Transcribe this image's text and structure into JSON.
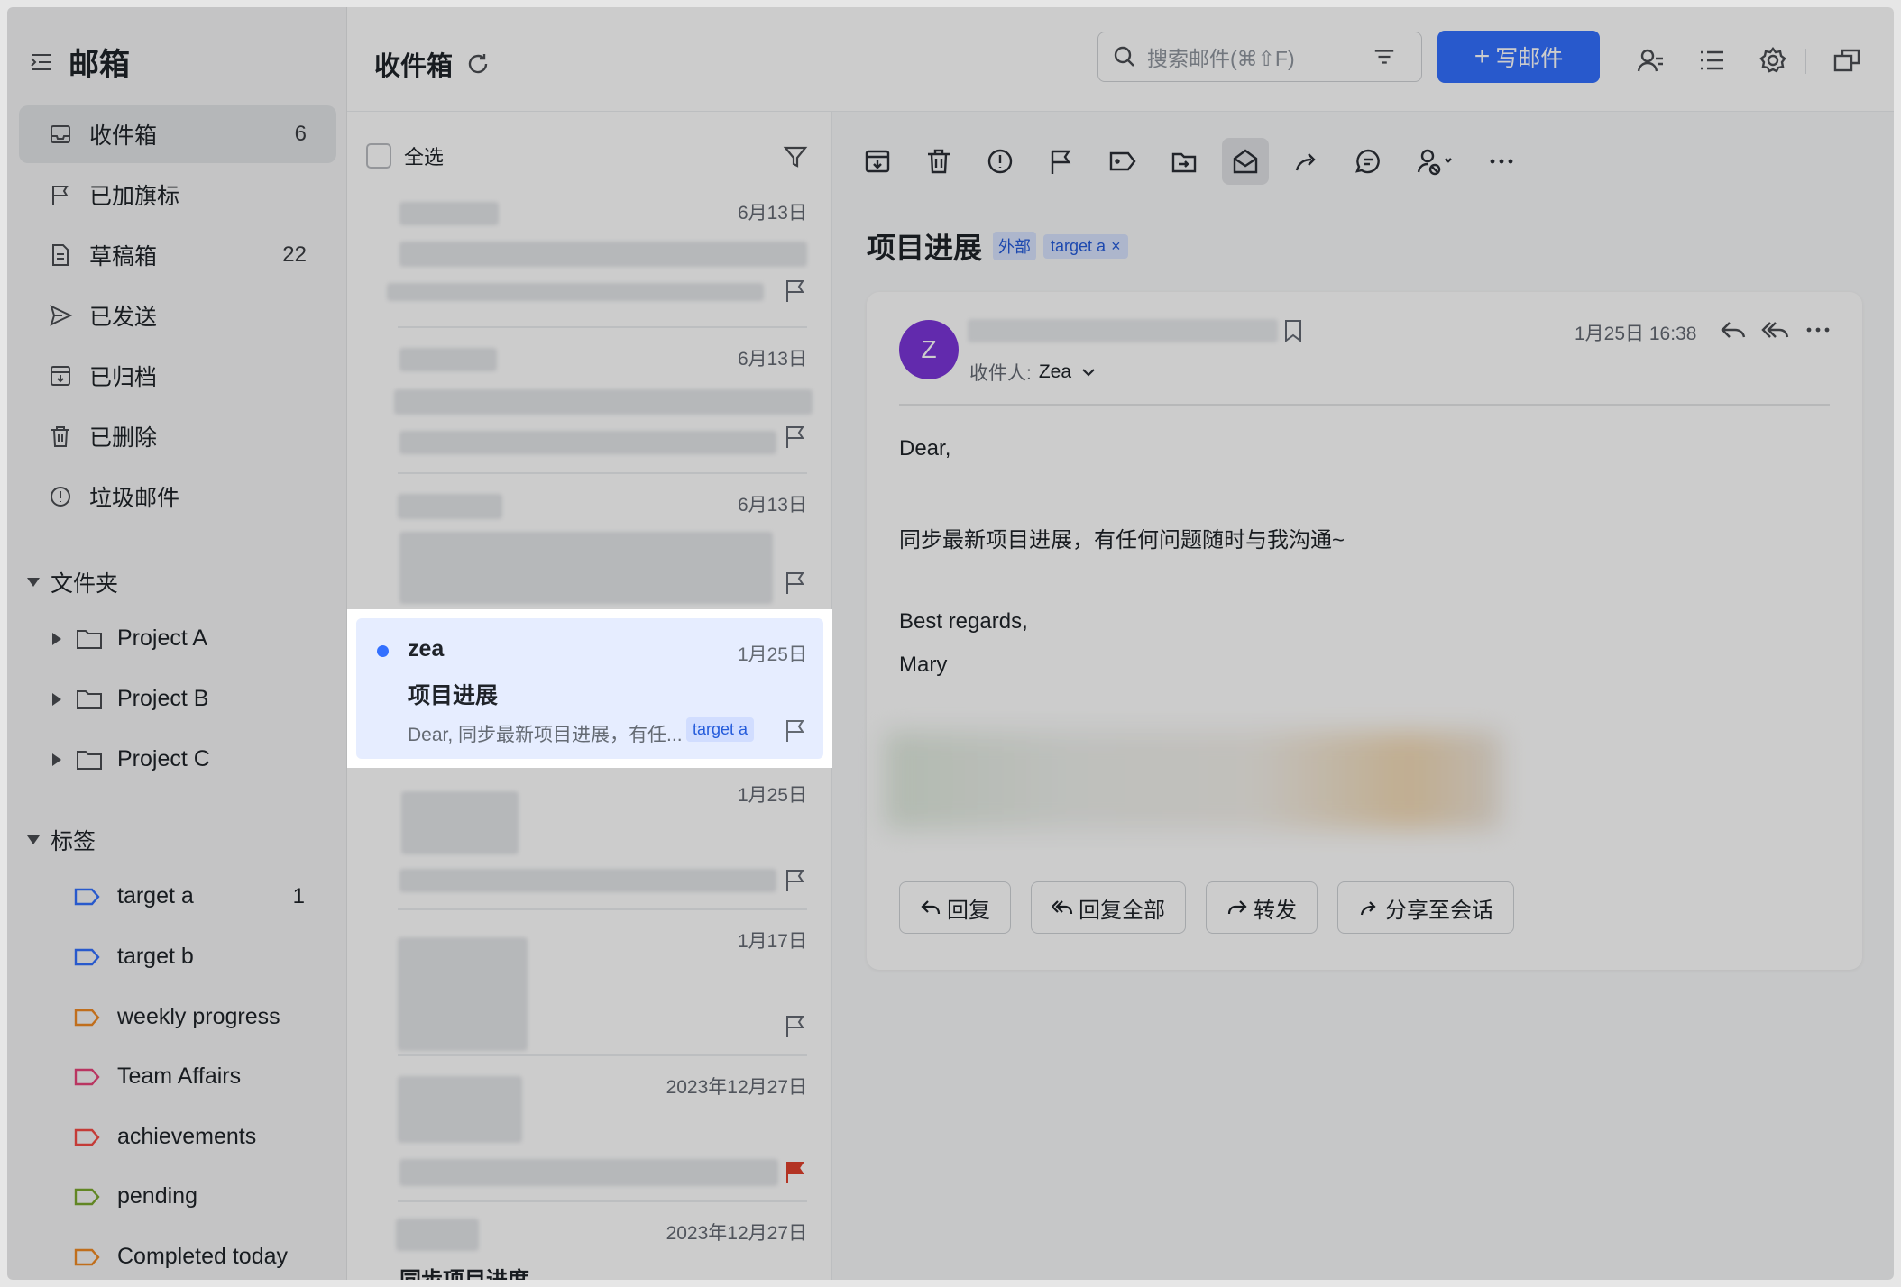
{
  "sidebar": {
    "title": "邮箱",
    "nav": [
      {
        "label": "收件箱",
        "count": "6",
        "icon": "inbox-icon"
      },
      {
        "label": "已加旗标",
        "count": "",
        "icon": "flag-icon"
      },
      {
        "label": "草稿箱",
        "count": "22",
        "icon": "draft-icon"
      },
      {
        "label": "已发送",
        "count": "",
        "icon": "send-icon"
      },
      {
        "label": "已归档",
        "count": "",
        "icon": "archive-icon"
      },
      {
        "label": "已删除",
        "count": "",
        "icon": "trash-icon"
      },
      {
        "label": "垃圾邮件",
        "count": "",
        "icon": "spam-icon"
      }
    ],
    "folders_title": "文件夹",
    "folders": [
      "Project A",
      "Project B",
      "Project C"
    ],
    "tags_title": "标签",
    "tags": [
      {
        "label": "target a",
        "count": "1",
        "color": "#3370ff"
      },
      {
        "label": "target b",
        "count": "",
        "color": "#3370ff"
      },
      {
        "label": "weekly progress",
        "count": "",
        "color": "#f08a24"
      },
      {
        "label": "Team Affairs",
        "count": "",
        "color": "#e8437a"
      },
      {
        "label": "achievements",
        "count": "",
        "color": "#f54a45"
      },
      {
        "label": "pending",
        "count": "",
        "color": "#7aa82e"
      },
      {
        "label": "Completed today",
        "count": "",
        "color": "#f08a24"
      }
    ]
  },
  "topbar": {
    "title": "收件箱",
    "search_placeholder": "搜索邮件(⌘⇧F)",
    "compose_label": "写邮件"
  },
  "list": {
    "select_all": "全选",
    "rows": [
      {
        "date": "6月13日"
      },
      {
        "date": "6月13日"
      },
      {
        "date": "6月13日"
      },
      {
        "date": "1月25日"
      },
      {
        "date": "1月17日"
      },
      {
        "date": "2023年12月27日"
      },
      {
        "date": "2023年12月27日",
        "subject_fragment": "同步项目进度"
      }
    ],
    "selected": {
      "sender": "zea",
      "date": "1月25日",
      "subject": "项目进展",
      "preview": "Dear, 同步最新项目进展，有任...",
      "tag": "target a"
    }
  },
  "reader": {
    "subject": "项目进展",
    "external_badge": "外部",
    "tag": "target a",
    "tag_remove": "×",
    "avatar_letter": "Z",
    "to_label": "收件人:",
    "to_name": "Zea",
    "time": "1月25日 16:38",
    "body": {
      "greeting": "Dear,",
      "line1": "同步最新项目进展，有任何问题随时与我沟通~",
      "closing": "Best regards,",
      "signature": "Mary"
    },
    "actions": {
      "reply": "回复",
      "reply_all": "回复全部",
      "forward": "转发",
      "share": "分享至会话"
    }
  },
  "colors": {
    "accent": "#3370ff",
    "avatar": "#7b35d9",
    "selected_row": "#e6edff",
    "flag_red": "#e0402c"
  }
}
